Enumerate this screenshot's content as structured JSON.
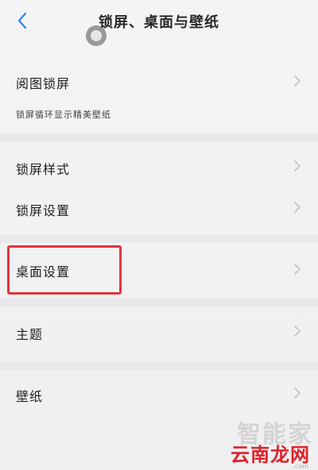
{
  "header": {
    "title": "锁屏、桌面与壁纸",
    "back_icon": "chevron-left-icon"
  },
  "items": [
    {
      "label": "阅图锁屏",
      "subtitle": "锁屏循环显示精美壁纸"
    },
    {
      "label": "锁屏样式"
    },
    {
      "label": "锁屏设置"
    },
    {
      "label": "桌面设置",
      "highlighted": true
    },
    {
      "label": "主题"
    },
    {
      "label": "壁纸"
    }
  ],
  "watermark": {
    "top_text": "智能家",
    "bottom_text": "云南龙网",
    "url": ".com"
  },
  "colors": {
    "accent_back": "#2f7df6",
    "highlight": "#e2333c",
    "watermark_red": "#e0222b"
  }
}
